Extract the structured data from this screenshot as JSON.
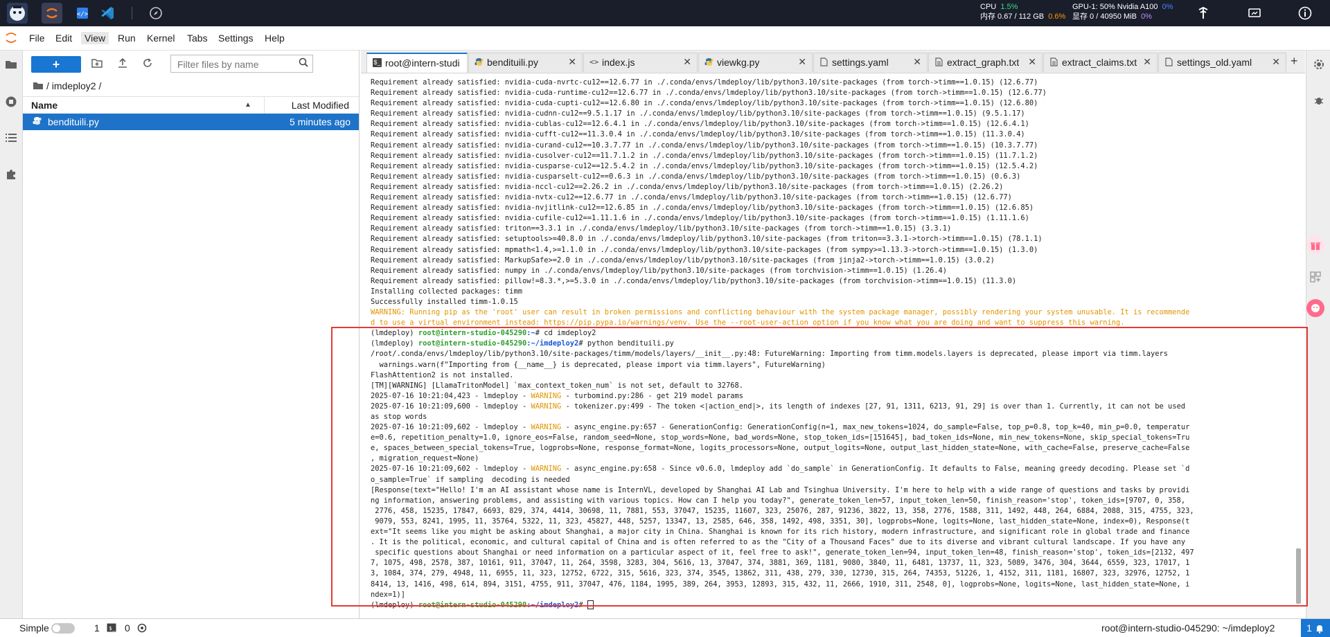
{
  "topbar": {
    "cpu_label": "CPU",
    "cpu_value": "1.5%",
    "mem_label": "内存 0.67 / 112 GB",
    "mem_value": "0.6%",
    "gpu_label": "GPU-1: 50% Nvidia A100",
    "gpu_value": "0%",
    "vram_label": "显存 0 / 40950 MiB",
    "vram_value": "0%"
  },
  "menu": [
    "File",
    "Edit",
    "View",
    "Run",
    "Kernel",
    "Tabs",
    "Settings",
    "Help"
  ],
  "filebrowser": {
    "new_label": "+",
    "filter_placeholder": "Filter files by name",
    "breadcrumb": "/ imdeploy2 /",
    "col_name": "Name",
    "col_modified": "Last Modified",
    "files": [
      {
        "name": "bendituili.py",
        "modified": "5 minutes ago"
      }
    ]
  },
  "tabs": [
    {
      "label": "root@intern-studi",
      "icon": "terminal-icon"
    },
    {
      "label": "bendituili.py",
      "icon": "python-icon"
    },
    {
      "label": "index.js",
      "icon": "code-icon"
    },
    {
      "label": "viewkg.py",
      "icon": "python-icon"
    },
    {
      "label": "settings.yaml",
      "icon": "file-icon"
    },
    {
      "label": "extract_graph.txt",
      "icon": "text-file-icon"
    },
    {
      "label": "extract_claims.txt",
      "icon": "text-file-icon"
    },
    {
      "label": "settings_old.yaml",
      "icon": "file-icon"
    }
  ],
  "terminal": {
    "requirements": [
      "nvidia-cuda-nvrtc-cu12==12.6.77 in ./.conda/envs/lmdeploy/lib/python3.10/site-packages (from torch->timm==1.0.15) (12.6.77)",
      "nvidia-cuda-runtime-cu12==12.6.77 in ./.conda/envs/lmdeploy/lib/python3.10/site-packages (from torch->timm==1.0.15) (12.6.77)",
      "nvidia-cuda-cupti-cu12==12.6.80 in ./.conda/envs/lmdeploy/lib/python3.10/site-packages (from torch->timm==1.0.15) (12.6.80)",
      "nvidia-cudnn-cu12==9.5.1.17 in ./.conda/envs/lmdeploy/lib/python3.10/site-packages (from torch->timm==1.0.15) (9.5.1.17)",
      "nvidia-cublas-cu12==12.6.4.1 in ./.conda/envs/lmdeploy/lib/python3.10/site-packages (from torch->timm==1.0.15) (12.6.4.1)",
      "nvidia-cufft-cu12==11.3.0.4 in ./.conda/envs/lmdeploy/lib/python3.10/site-packages (from torch->timm==1.0.15) (11.3.0.4)",
      "nvidia-curand-cu12==10.3.7.77 in ./.conda/envs/lmdeploy/lib/python3.10/site-packages (from torch->timm==1.0.15) (10.3.7.77)",
      "nvidia-cusolver-cu12==11.7.1.2 in ./.conda/envs/lmdeploy/lib/python3.10/site-packages (from torch->timm==1.0.15) (11.7.1.2)",
      "nvidia-cusparse-cu12==12.5.4.2 in ./.conda/envs/lmdeploy/lib/python3.10/site-packages (from torch->timm==1.0.15) (12.5.4.2)",
      "nvidia-cusparselt-cu12==0.6.3 in ./.conda/envs/lmdeploy/lib/python3.10/site-packages (from torch->timm==1.0.15) (0.6.3)",
      "nvidia-nccl-cu12==2.26.2 in ./.conda/envs/lmdeploy/lib/python3.10/site-packages (from torch->timm==1.0.15) (2.26.2)",
      "nvidia-nvtx-cu12==12.6.77 in ./.conda/envs/lmdeploy/lib/python3.10/site-packages (from torch->timm==1.0.15) (12.6.77)",
      "nvidia-nvjitlink-cu12==12.6.85 in ./.conda/envs/lmdeploy/lib/python3.10/site-packages (from torch->timm==1.0.15) (12.6.85)",
      "nvidia-cufile-cu12==1.11.1.6 in ./.conda/envs/lmdeploy/lib/python3.10/site-packages (from torch->timm==1.0.15) (1.11.1.6)",
      "triton==3.3.1 in ./.conda/envs/lmdeploy/lib/python3.10/site-packages (from torch->timm==1.0.15) (3.3.1)",
      "setuptools>=40.8.0 in ./.conda/envs/lmdeploy/lib/python3.10/site-packages (from triton==3.3.1->torch->timm==1.0.15) (78.1.1)",
      "mpmath<1.4,>=1.1.0 in ./.conda/envs/lmdeploy/lib/python3.10/site-packages (from sympy>=1.13.3->torch->timm==1.0.15) (1.3.0)",
      "MarkupSafe>=2.0 in ./.conda/envs/lmdeploy/lib/python3.10/site-packages (from jinja2->torch->timm==1.0.15) (3.0.2)",
      "numpy in ./.conda/envs/lmdeploy/lib/python3.10/site-packages (from torchvision->timm==1.0.15) (1.26.4)",
      "pillow!=8.3.*,>=5.3.0 in ./.conda/envs/lmdeploy/lib/python3.10/site-packages (from torchvision->timm==1.0.15) (11.3.0)"
    ],
    "req_prefix": "Requirement already satisfied: ",
    "installing": "Installing collected packages: timm",
    "installed": "Successfully installed timm-1.0.15",
    "pip_warning_1": "WARNING: Running pip as the 'root' user can result in broken permissions and conflicting behaviour with the system package manager, possibly rendering your system unusable. It is recommende",
    "pip_warning_2": "d to use a virtual environment instead: https://pip.pypa.io/warnings/venv. Use the --root-user-action option if you know what you are doing and want to suppress this warning.",
    "env": "(lmdeploy) ",
    "user": "root@intern-studio-045290",
    "path_home": ":~",
    "path_proj": ":~/imdeploy2",
    "cmd_cd": "# cd imdeploy2",
    "cmd_py": "# python bendituili.py",
    "cmd_last": "#",
    "fw_1": "/root/.conda/envs/lmdeploy/lib/python3.10/site-packages/timm/models/layers/__init__.py:48: FutureWarning: Importing from timm.models.layers is deprecated, please import via timm.layers",
    "fw_2": "  warnings.warn(f\"Importing from {__name__} is deprecated, please import via timm.layers\", FutureWarning)",
    "flash": "FlashAttention2 is not installed.",
    "tm_warning": "[TM][WARNING] [LlamaTritonModel] `max_context_token_num` is not set, default to 32768.",
    "log1_pre": "2025-07-16 10:21:04,423 - lmdeploy - ",
    "log1_post": " - turbomind.py:286 - get 219 model params",
    "log2_pre": "2025-07-16 10:21:09,600 - lmdeploy - ",
    "log2_post": " - tokenizer.py:499 - The token <|action_end|>, its length of indexes [27, 91, 1311, 6213, 91, 29] is over than 1. Currently, it can not be used",
    "log2_cont": "as stop words",
    "log3_pre": "2025-07-16 10:21:09,602 - lmdeploy - ",
    "log3_post": " - async_engine.py:657 - GenerationConfig: GenerationConfig(n=1, max_new_tokens=1024, do_sample=False, top_p=0.8, top_k=40, min_p=0.0, temperatur",
    "log3_c1": "e=0.6, repetition_penalty=1.0, ignore_eos=False, random_seed=None, stop_words=None, bad_words=None, stop_token_ids=[151645], bad_token_ids=None, min_new_tokens=None, skip_special_tokens=Tru",
    "log3_c2": "e, spaces_between_special_tokens=True, logprobs=None, response_format=None, logits_processors=None, output_logits=None, output_last_hidden_state=None, with_cache=False, preserve_cache=False",
    "log3_c3": ", migration_request=None)",
    "log4_pre": "2025-07-16 10:21:09,602 - lmdeploy - ",
    "log4_post": " - async_engine.py:658 - Since v0.6.0, lmdeploy add `do_sample` in GenerationConfig. It defaults to False, meaning greedy decoding. Please set `d",
    "log4_cont": "o_sample=True` if sampling  decoding is needed",
    "warning_word": "WARNING",
    "response": [
      "[Response(text=\"Hello! I'm an AI assistant whose name is InternVL, developed by Shanghai AI Lab and Tsinghua University. I'm here to help with a wide range of questions and tasks by providi",
      "ng information, answering problems, and assisting with various topics. How can I help you today?\", generate_token_len=57, input_token_len=50, finish_reason='stop', token_ids=[9707, 0, 358,",
      " 2776, 458, 15235, 17847, 6693, 829, 374, 4414, 30698, 11, 7881, 553, 37047, 15235, 11607, 323, 25076, 287, 91236, 3822, 13, 358, 2776, 1588, 311, 1492, 448, 264, 6884, 2088, 315, 4755, 323,",
      " 9079, 553, 8241, 1995, 11, 35764, 5322, 11, 323, 45827, 448, 5257, 13347, 13, 2585, 646, 358, 1492, 498, 3351, 30], logprobs=None, logits=None, last_hidden_state=None, index=0), Response(t",
      "ext=\"It seems like you might be asking about Shanghai, a major city in China. Shanghai is known for its rich history, modern infrastructure, and significant role in global trade and finance",
      ". It is the political, economic, and cultural capital of China and is often referred to as the \"City of a Thousand Faces\" due to its diverse and vibrant cultural landscape. If you have any",
      " specific questions about Shanghai or need information on a particular aspect of it, feel free to ask!\", generate_token_len=94, input_token_len=48, finish_reason='stop', token_ids=[2132, 497",
      "7, 1075, 498, 2578, 387, 10161, 911, 37047, 11, 264, 3598, 3283, 304, 5616, 13, 37047, 374, 3881, 369, 1181, 9080, 3840, 11, 6481, 13737, 11, 323, 5089, 3476, 304, 3644, 6559, 323, 17017, 1",
      "3, 1084, 374, 279, 4948, 11, 6955, 11, 323, 12752, 6722, 315, 5616, 323, 374, 3545, 13862, 311, 438, 279, 330, 12730, 315, 264, 74353, 51226, 1, 4152, 311, 1181, 16807, 323, 32976, 12752, 1",
      "8414, 13, 1416, 498, 614, 894, 3151, 4755, 911, 37047, 476, 1184, 1995, 389, 264, 3953, 12893, 315, 432, 11, 2666, 1910, 311, 2548, 0], logprobs=None, logits=None, last_hidden_state=None, i",
      "ndex=1)]"
    ]
  },
  "statusbar": {
    "mode_label": "Simple",
    "count1": "1",
    "count2": "0",
    "right_text": "root@intern-studio-045290: ~/imdeploy2",
    "notif_count": "1"
  }
}
